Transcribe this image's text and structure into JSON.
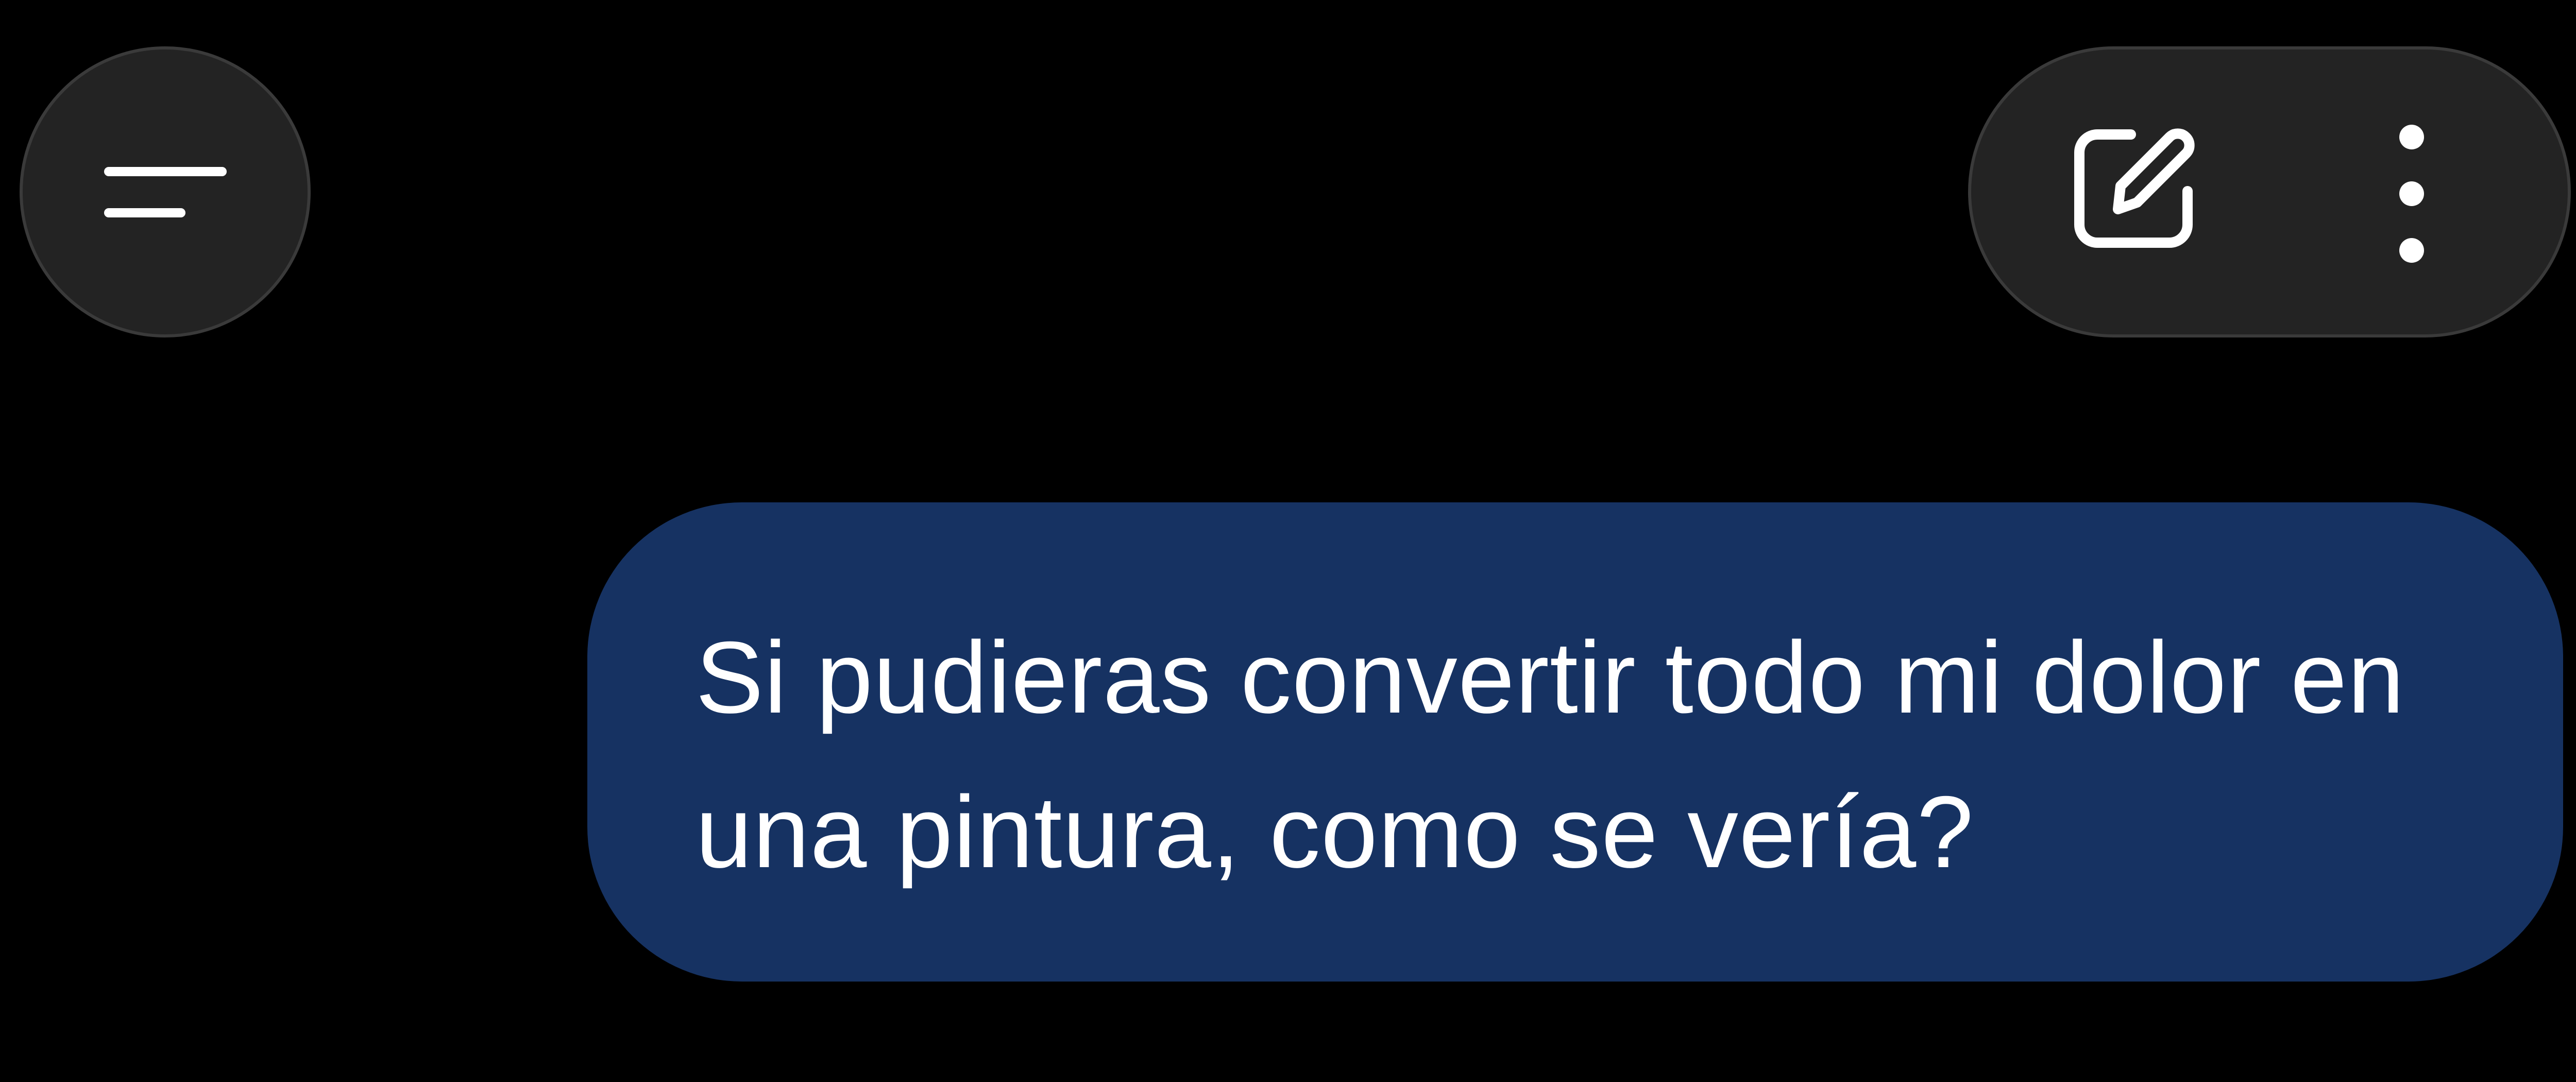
{
  "header": {
    "menu_icon": "menu-icon",
    "edit_icon": "edit-icon",
    "more_icon": "more-vertical-icon"
  },
  "conversation": {
    "user_message": "Si pudieras convertir todo mi dolor en una pintura, como se vería?"
  },
  "colors": {
    "background": "#000000",
    "button_fill": "#232323",
    "bubble_fill": "#163262",
    "text": "#ffffff"
  }
}
